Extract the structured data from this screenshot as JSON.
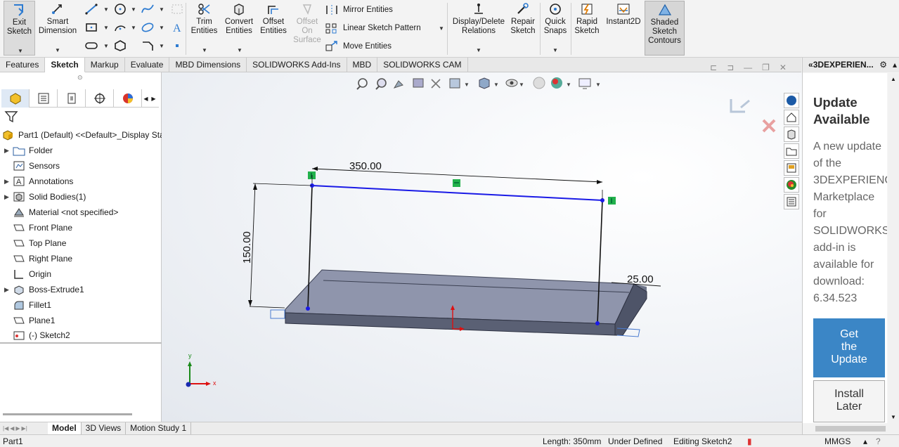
{
  "toolbar": {
    "exit_sketch": "Exit\nSketch",
    "smart_dimension": "Smart\nDimension",
    "trim": "Trim\nEntities",
    "convert": "Convert\nEntities",
    "offset": "Offset\nEntities",
    "offset_surface": "Offset\nOn\nSurface",
    "mirror": "Mirror Entities",
    "linear_pattern": "Linear Sketch Pattern",
    "move": "Move Entities",
    "display_delete": "Display/Delete\nRelations",
    "repair": "Repair\nSketch",
    "quick_snaps": "Quick\nSnaps",
    "rapid": "Rapid\nSketch",
    "instant2d": "Instant2D",
    "shaded": "Shaded\nSketch\nContours"
  },
  "tabs": [
    "Features",
    "Sketch",
    "Markup",
    "Evaluate",
    "MBD Dimensions",
    "SOLIDWORKS Add-Ins",
    "MBD",
    "SOLIDWORKS CAM"
  ],
  "active_tab": "Sketch",
  "tree": {
    "root": "Part1 (Default) <<Default>_Display Sta",
    "items": [
      {
        "label": "Folder",
        "icon": "folder-icon",
        "expandable": true
      },
      {
        "label": "Sensors",
        "icon": "sensor-icon",
        "expandable": false
      },
      {
        "label": "Annotations",
        "icon": "annotation-icon",
        "expandable": true
      },
      {
        "label": "Solid Bodies(1)",
        "icon": "solid-bodies-icon",
        "expandable": true
      },
      {
        "label": "Material <not specified>",
        "icon": "material-icon",
        "expandable": false
      },
      {
        "label": "Front Plane",
        "icon": "plane-icon",
        "expandable": false
      },
      {
        "label": "Top Plane",
        "icon": "plane-icon",
        "expandable": false
      },
      {
        "label": "Right Plane",
        "icon": "plane-icon",
        "expandable": false
      },
      {
        "label": "Origin",
        "icon": "origin-icon",
        "expandable": false
      },
      {
        "label": "Boss-Extrude1",
        "icon": "extrude-icon",
        "expandable": true
      },
      {
        "label": "Fillet1",
        "icon": "fillet-icon",
        "expandable": false
      },
      {
        "label": "Plane1",
        "icon": "plane-icon",
        "expandable": false
      },
      {
        "label": "(-) Sketch2",
        "icon": "sketch-icon",
        "expandable": false
      }
    ]
  },
  "viewport": {
    "dim_width": "350.00",
    "dim_height": "150.00",
    "dim_offset": "25.00",
    "triad_x": "x",
    "triad_y": "y"
  },
  "taskpane": {
    "title": "3DEXPERIEN...",
    "heading": "Update\nAvailable",
    "body": "A new update\nof the\n3DEXPERIENC\nMarketplace\nfor\nSOLIDWORKS\nadd-in is\navailable for\ndownload:\n6.34.523",
    "primary": "Get\nthe\nUpdate",
    "secondary": "Install\nLater"
  },
  "bottom_tabs": [
    "Model",
    "3D Views",
    "Motion Study 1"
  ],
  "active_bottom": "Model",
  "status": {
    "doc": "Part1",
    "length": "Length: 350mm",
    "state": "Under Defined",
    "editing": "Editing Sketch2",
    "units": "MMGS"
  },
  "colors": {
    "accent": "#3b86c6",
    "sketch_blue": "#1a1ae6",
    "relation_green": "#22b14c"
  }
}
